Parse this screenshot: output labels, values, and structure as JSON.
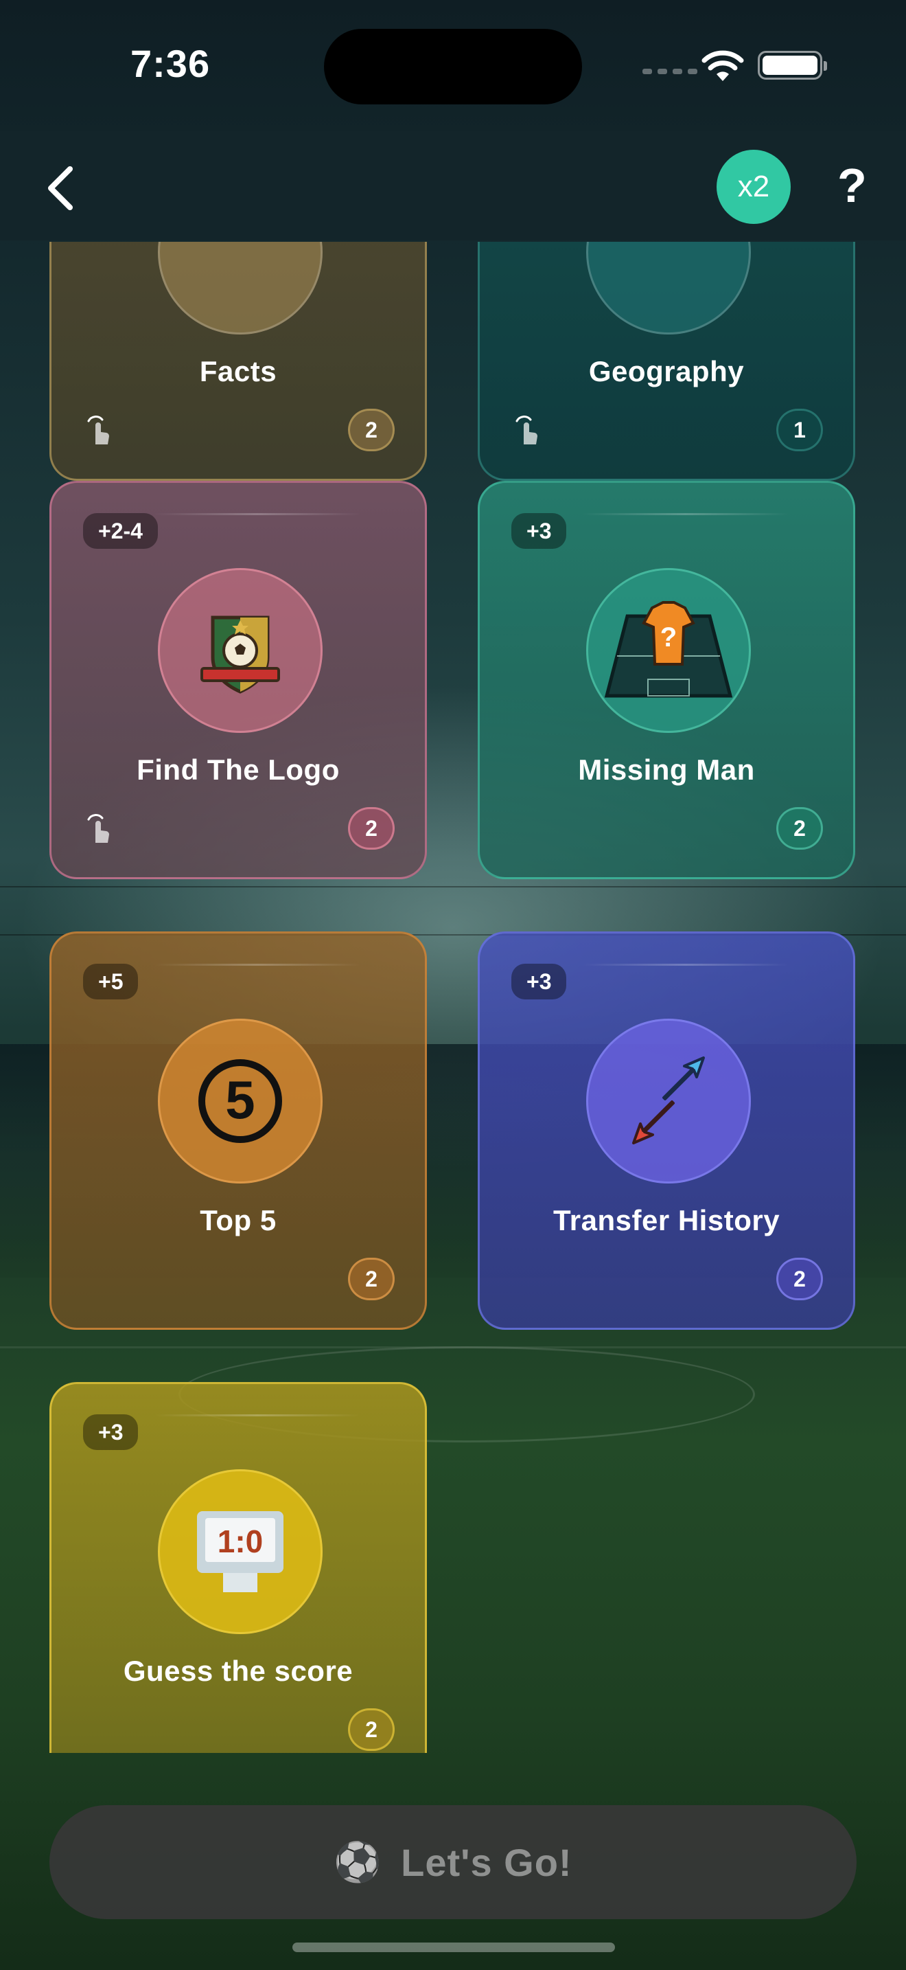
{
  "status_bar": {
    "time": "7:36"
  },
  "nav": {
    "multiplier_label": "x2",
    "help_label": "?"
  },
  "cards": {
    "facts": {
      "title": "Facts",
      "count": "2"
    },
    "geography": {
      "title": "Geography",
      "count": "1"
    },
    "find_the_logo": {
      "bonus": "+2-4",
      "title": "Find The Logo",
      "count": "2"
    },
    "missing_man": {
      "bonus": "+3",
      "title": "Missing Man",
      "count": "2",
      "emblem_text": "?"
    },
    "top5": {
      "bonus": "+5",
      "title": "Top 5",
      "count": "2",
      "emblem_text": "5"
    },
    "transfer_history": {
      "bonus": "+3",
      "title": "Transfer History",
      "count": "2"
    },
    "guess_the_score": {
      "bonus": "+3",
      "title": "Guess the score",
      "count": "2",
      "emblem_text": "1:0"
    }
  },
  "cta": {
    "icon": "soccer-ball-icon",
    "label": "Let's Go!"
  },
  "colors": {
    "accent": "#31c8a3",
    "logo_card": "#d27896",
    "missing_card": "#46c8aa",
    "top5_card": "#dc8c3c",
    "transfer_card": "#6e78e6",
    "score_card": "#e6c83c"
  }
}
